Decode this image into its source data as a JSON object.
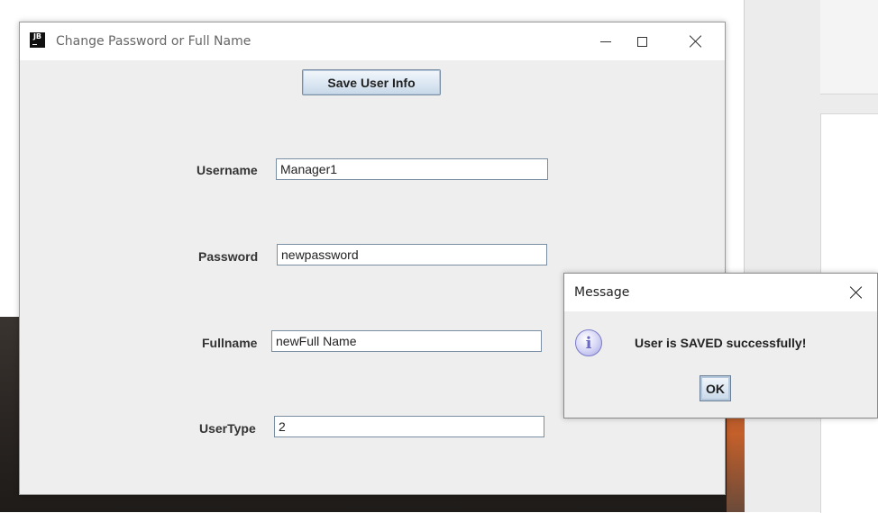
{
  "main_window": {
    "title": "Change Password or Full Name",
    "app_icon_text": "JB",
    "save_label": "Save User Info",
    "fields": {
      "username": {
        "label": "Username",
        "value": "Manager1"
      },
      "password": {
        "label": "Password",
        "value": "newpassword"
      },
      "fullname": {
        "label": "Fullname",
        "value": "newFull Name"
      },
      "usertype": {
        "label": "UserType",
        "value": "2"
      }
    }
  },
  "dialog": {
    "title": "Message",
    "icon": "info-icon",
    "icon_glyph": "i",
    "message": "User is SAVED successfully!",
    "ok_label": "OK"
  },
  "colors": {
    "window_bg": "#eeeeee",
    "button_border": "#7a8ea3",
    "info_icon": "#a5a5e6"
  }
}
